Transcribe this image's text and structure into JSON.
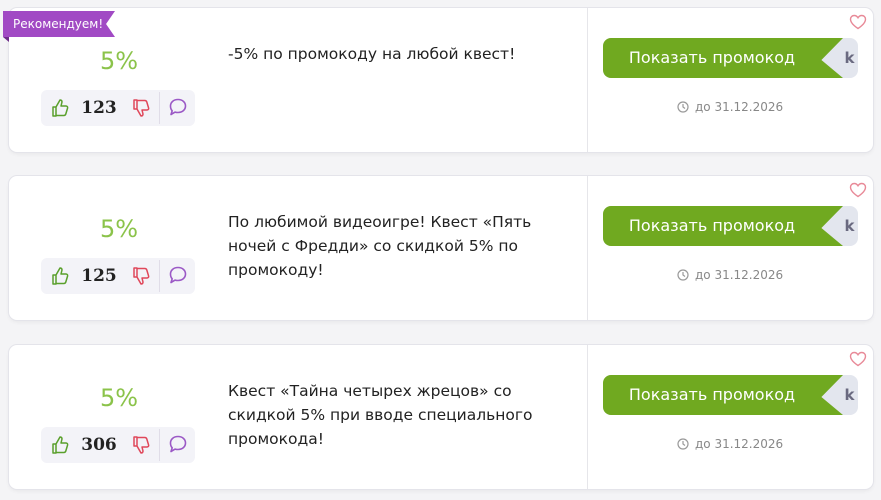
{
  "badge": "Рекомендуем!",
  "colors": {
    "accent_green": "#70a920",
    "percent_green": "#8bc34a",
    "badge_purple": "#a14ac4"
  },
  "icons": {
    "like": "thumb-up-icon",
    "dislike": "thumb-down-icon",
    "comment": "speech-bubble-icon",
    "expiry": "clock-icon",
    "favorite": "heart-icon"
  },
  "offers": [
    {
      "discount": "5%",
      "votes": "123",
      "description": "-5% по промокоду на любой квест!",
      "button_label": "Показать промокод",
      "button_tail": "k",
      "expiry": "до 31.12.2026"
    },
    {
      "discount": "5%",
      "votes": "125",
      "description": "По любимой видеоигре! Квест «Пять ночей с Фредди» со скидкой 5% по промокоду!",
      "button_label": "Показать промокод",
      "button_tail": "k",
      "expiry": "до 31.12.2026"
    },
    {
      "discount": "5%",
      "votes": "306",
      "description": "Квест «Тайна четырех жрецов» со скидкой 5% при вводе специального промокода!",
      "button_label": "Показать промокод",
      "button_tail": "k",
      "expiry": "до 31.12.2026"
    }
  ]
}
